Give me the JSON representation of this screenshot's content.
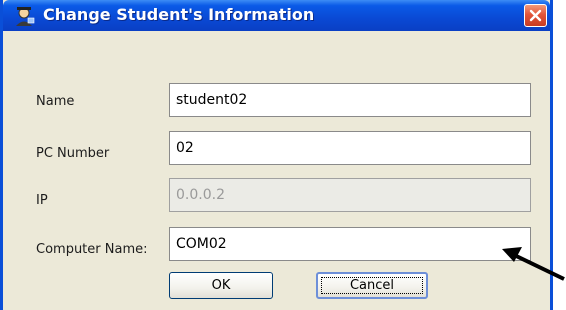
{
  "window": {
    "title": "Change Student's Information",
    "app_icon": "student-icon",
    "close_icon": "close-icon"
  },
  "form": {
    "name_label": "Name",
    "name_value": "student02",
    "pc_number_label": "PC Number",
    "pc_number_value": "02",
    "ip_label": "IP",
    "ip_value": "0.0.0.2",
    "computer_name_label": "Computer Name:",
    "computer_name_value": "COM02"
  },
  "buttons": {
    "ok_label": "OK",
    "cancel_label": "Cancel"
  },
  "colors": {
    "titlebar": "#0a49d4",
    "dialog_bg": "#ece9d8",
    "close_button": "#e2553a",
    "arrow": "#000000"
  }
}
